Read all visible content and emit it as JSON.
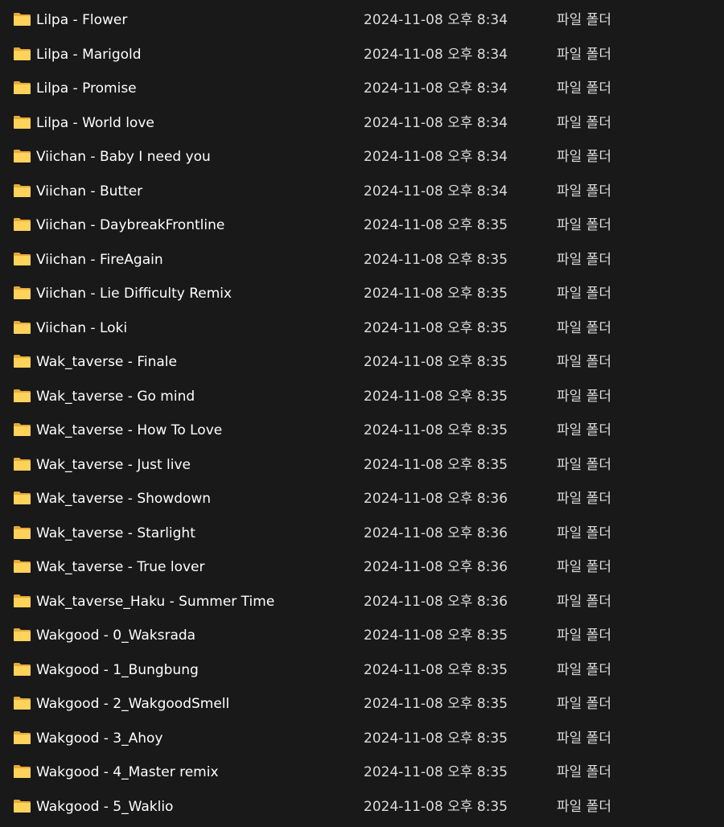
{
  "colors": {
    "background": "#191919",
    "text": "#ffffff",
    "folder_back": "#e8a93a",
    "folder_front": "#ffd25a"
  },
  "icons": {
    "folder": "folder-icon"
  },
  "files": [
    {
      "name": "Lilpa - Flower",
      "date": "2024-11-08 오후 8:34",
      "type": "파일 폴더"
    },
    {
      "name": "Lilpa - Marigold",
      "date": "2024-11-08 오후 8:34",
      "type": "파일 폴더"
    },
    {
      "name": "Lilpa - Promise",
      "date": "2024-11-08 오후 8:34",
      "type": "파일 폴더"
    },
    {
      "name": "Lilpa - World love",
      "date": "2024-11-08 오후 8:34",
      "type": "파일 폴더"
    },
    {
      "name": "Viichan - Baby I need you",
      "date": "2024-11-08 오후 8:34",
      "type": "파일 폴더"
    },
    {
      "name": "Viichan - Butter",
      "date": "2024-11-08 오후 8:34",
      "type": "파일 폴더"
    },
    {
      "name": "Viichan - DaybreakFrontline",
      "date": "2024-11-08 오후 8:35",
      "type": "파일 폴더"
    },
    {
      "name": "Viichan - FireAgain",
      "date": "2024-11-08 오후 8:35",
      "type": "파일 폴더"
    },
    {
      "name": "Viichan - Lie Difficulty Remix",
      "date": "2024-11-08 오후 8:35",
      "type": "파일 폴더"
    },
    {
      "name": "Viichan - Loki",
      "date": "2024-11-08 오후 8:35",
      "type": "파일 폴더"
    },
    {
      "name": "Wak_taverse - Finale",
      "date": "2024-11-08 오후 8:35",
      "type": "파일 폴더"
    },
    {
      "name": "Wak_taverse - Go mind",
      "date": "2024-11-08 오후 8:35",
      "type": "파일 폴더"
    },
    {
      "name": "Wak_taverse - How To Love",
      "date": "2024-11-08 오후 8:35",
      "type": "파일 폴더"
    },
    {
      "name": "Wak_taverse - Just live",
      "date": "2024-11-08 오후 8:35",
      "type": "파일 폴더"
    },
    {
      "name": "Wak_taverse - Showdown",
      "date": "2024-11-08 오후 8:36",
      "type": "파일 폴더"
    },
    {
      "name": "Wak_taverse - Starlight",
      "date": "2024-11-08 오후 8:36",
      "type": "파일 폴더"
    },
    {
      "name": "Wak_taverse - True lover",
      "date": "2024-11-08 오후 8:36",
      "type": "파일 폴더"
    },
    {
      "name": "Wak_taverse_Haku - Summer Time",
      "date": "2024-11-08 오후 8:36",
      "type": "파일 폴더"
    },
    {
      "name": "Wakgood - 0_Waksrada",
      "date": "2024-11-08 오후 8:35",
      "type": "파일 폴더"
    },
    {
      "name": "Wakgood - 1_Bungbung",
      "date": "2024-11-08 오후 8:35",
      "type": "파일 폴더"
    },
    {
      "name": "Wakgood - 2_WakgoodSmell",
      "date": "2024-11-08 오후 8:35",
      "type": "파일 폴더"
    },
    {
      "name": "Wakgood - 3_Ahoy",
      "date": "2024-11-08 오후 8:35",
      "type": "파일 폴더"
    },
    {
      "name": "Wakgood - 4_Master remix",
      "date": "2024-11-08 오후 8:35",
      "type": "파일 폴더"
    },
    {
      "name": "Wakgood - 5_Waklio",
      "date": "2024-11-08 오후 8:35",
      "type": "파일 폴더"
    }
  ]
}
